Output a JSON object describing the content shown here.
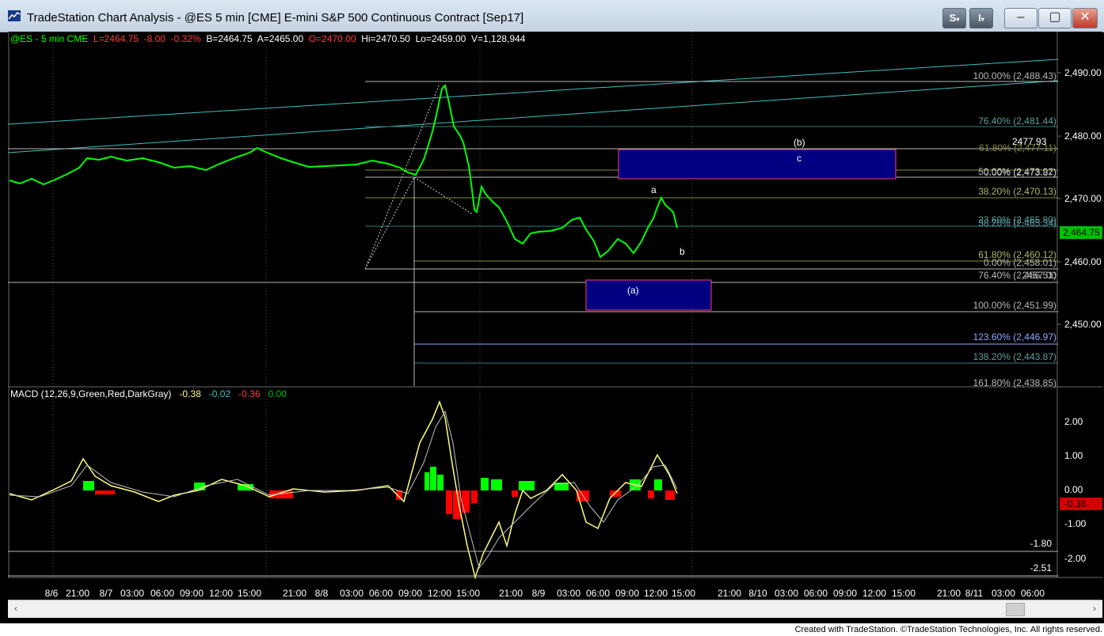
{
  "window": {
    "title": "TradeStation Chart Analysis - @ES 5 min [CME] E-mini S&P 500 Continuous Contract [Sep17]",
    "s_menu": "S",
    "i_menu": "I",
    "minimize": "‒",
    "maximize": "▢",
    "close": "✕"
  },
  "price_info": {
    "symbol": "@ES - 5 min  CME",
    "last": "L=2464.75",
    "net": "-8.00",
    "pct": "-0.32%",
    "bid": "B=2464.75",
    "ask": "A=2465.00",
    "open": "O=2470.00",
    "high": "Hi=2470.50",
    "low": "Lo=2459.00",
    "volume": "V=1,128,944"
  },
  "macd_info": {
    "name": "MACD (12,26,9,Green,Red,DarkGray)",
    "v1": "-0.38",
    "v2": "-0.02",
    "v3": "-0.36",
    "v4": "0.00"
  },
  "price_axis": [
    "2,490.00",
    "2,480.00",
    "2,470.00",
    "2,460.00",
    "2,450.00"
  ],
  "current_price_tag": "2,464.75",
  "macd_axis": [
    "2.00",
    "1.00",
    "0.00",
    "-1.00",
    "-2.00"
  ],
  "macd_tag": "-0.36",
  "macd_levels": [
    "-1.80",
    "-2.51"
  ],
  "time_axis": [
    "8/6",
    "21:00",
    "8/7",
    "03:00",
    "06:00",
    "09:00",
    "12:00",
    "15:00",
    "21:00",
    "8/8",
    "03:00",
    "06:00",
    "09:00",
    "12:00",
    "15:00",
    "21:00",
    "8/9",
    "03:00",
    "06:00",
    "09:00",
    "12:00",
    "15:00",
    "21:00",
    "8/10",
    "03:00",
    "06:00",
    "09:00",
    "12:00",
    "15:00",
    "21:00",
    "8/11",
    "03:00",
    "06:00"
  ],
  "fib_labels": [
    {
      "text": "100.00% (2,488.43)",
      "color": "#b8b8b8"
    },
    {
      "text": "76.40% (2,481.44)",
      "color": "#5f9ea0"
    },
    {
      "text": "61.80% (2,477.11)",
      "color": "#8b8b3a"
    },
    {
      "text": "50.00% (2,473.92)",
      "color": "#b8b8b8"
    },
    {
      "text": "0.00% (2,473.87)",
      "color": "#b8b8b8"
    },
    {
      "text": "38.20% (2,470.13)",
      "color": "#b5b56a"
    },
    {
      "text": "23.60% (2,465.80)",
      "color": "#5f9ea0"
    },
    {
      "text": "38.20% (2,465.34)",
      "color": "#5f9ea0"
    },
    {
      "text": "61.80% (2,460.12)",
      "color": "#b5b56a"
    },
    {
      "text": "0.00% (2,458.01)",
      "color": "#b8b8b8"
    },
    {
      "text": "76.40% (2,456.51)",
      "color": "#b8b8b8"
    },
    {
      "text": "2457.00",
      "color": "#b8b8b8"
    },
    {
      "text": "100.00% (2,451.99)",
      "color": "#b8b8b8"
    },
    {
      "text": "123.60% (2,446.97)",
      "color": "#8fa8ff"
    },
    {
      "text": "138.20% (2,443.87)",
      "color": "#5f9ea0"
    },
    {
      "text": "161.80% (2,438.85)",
      "color": "#b8b8b8"
    }
  ],
  "annotations": {
    "b_upper": "(b)",
    "level_2477": "2477.93",
    "c": "c",
    "a": "a",
    "b": "b",
    "a_lower": "(a)"
  },
  "scrollbar": {
    "left": "‹",
    "right": "›"
  },
  "footer": "Created with TradeStation. ©TradeStation Technologies, Inc. All rights reserved.",
  "colors": {
    "up": "#00ff00",
    "down": "#ff0000",
    "accent_label": "#00ff00",
    "tag_bg": "#00c000",
    "macd_tag_bg": "#d40000"
  }
}
